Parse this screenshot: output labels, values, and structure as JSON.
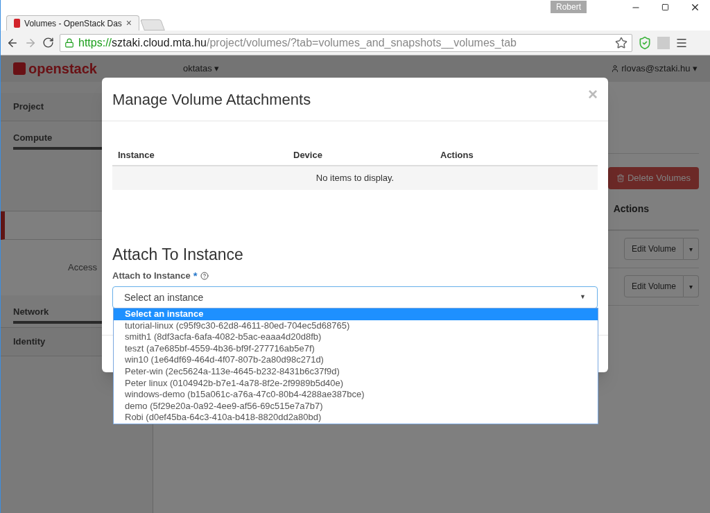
{
  "browser": {
    "user": "Robert",
    "tab": {
      "title": "Volumes - OpenStack Das",
      "close": "×"
    },
    "url": {
      "scheme": "https://",
      "host": "sztaki.cloud.mta.hu",
      "path": "/project/volumes/?tab=volumes_and_snapshots__volumes_tab"
    }
  },
  "header": {
    "logo": "openstack",
    "project": "oktatas",
    "project_caret": "▾",
    "user": "rlovas@sztaki.hu",
    "user_caret": "▾"
  },
  "sidebar": {
    "items": [
      {
        "label": "Project",
        "kind": "panel",
        "selected": false
      },
      {
        "label": "Compute",
        "kind": "group",
        "expanded": true,
        "selected": false
      },
      {
        "kind": "active",
        "selected": true
      },
      {
        "label": "Access",
        "kind": "sub",
        "selected": false
      },
      {
        "label": "Network",
        "kind": "group",
        "expanded": false,
        "selected": false
      },
      {
        "label": "Identity",
        "kind": "panel",
        "selected": false
      }
    ]
  },
  "content": {
    "delete_button": "Delete Volumes",
    "actions_header": "Actions",
    "rows": [
      {
        "action": "Edit Volume",
        "caret": "▾"
      },
      {
        "action": "Edit Volume",
        "caret": "▾"
      }
    ]
  },
  "modal": {
    "title": "Manage Volume Attachments",
    "close": "×",
    "table": {
      "columns": [
        "Instance",
        "Device",
        "Actions"
      ],
      "empty": "No items to display."
    },
    "section_title": "Attach To Instance",
    "field": {
      "label": "Attach to Instance",
      "required": "*",
      "value": "Select an instance",
      "caret": "▼"
    },
    "options": [
      {
        "label": "Select an instance",
        "selected": true
      },
      {
        "label": "tutorial-linux (c95f9c30-62d8-4611-80ed-704ec5d68765)",
        "selected": false
      },
      {
        "label": "smith1 (8df3acfa-6afa-4082-b5ac-eaaa4d20d8fb)",
        "selected": false
      },
      {
        "label": "teszt (a7e685bf-4559-4b36-bf9f-277716ab5e7f)",
        "selected": false
      },
      {
        "label": "win10 (1e64df69-464d-4f07-807b-2a80d98c271d)",
        "selected": false
      },
      {
        "label": "Peter-win (2ec5624a-113e-4645-b232-8431b6c37f9d)",
        "selected": false
      },
      {
        "label": "Peter linux (0104942b-b7e1-4a78-8f2e-2f9989b5d40e)",
        "selected": false
      },
      {
        "label": "windows-demo (b15a061c-a76a-47c0-80b4-4288ae387bce)",
        "selected": false
      },
      {
        "label": "demo (5f29e20a-0a92-4ee9-af56-69c515e7a7b7)",
        "selected": false
      },
      {
        "label": "Robi (d0ef45ba-64c3-410a-b418-8820dd2a80bd)",
        "selected": false
      }
    ]
  }
}
